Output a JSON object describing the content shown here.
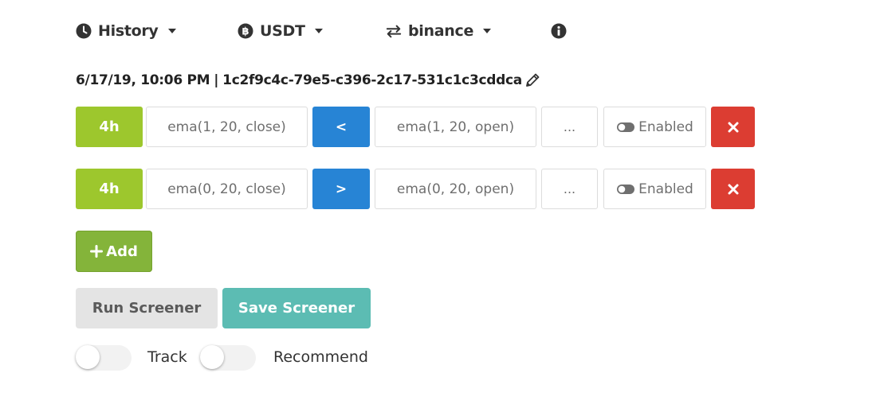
{
  "toolbar": {
    "history": {
      "label": "History",
      "icon": "clock-icon"
    },
    "currency": {
      "label": "USDT",
      "icon": "bitcoin-icon"
    },
    "exchange": {
      "label": "binance",
      "icon": "exchange-arrows-icon"
    },
    "info_icon": "info-icon"
  },
  "screener": {
    "date": "6/17/19, 10:06 PM",
    "separator": "|",
    "id": "1c2f9c4c-79e5-c396-2c17-531c1c3cddca",
    "edit_icon": "pencil-icon"
  },
  "conditions": [
    {
      "timeframe": "4h",
      "left": "ema(1, 20, close)",
      "operator": "<",
      "right": "ema(1, 20, open)",
      "more": "...",
      "enabled_label": "Enabled"
    },
    {
      "timeframe": "4h",
      "left": "ema(0, 20, close)",
      "operator": ">",
      "right": "ema(0, 20, open)",
      "more": "...",
      "enabled_label": "Enabled"
    }
  ],
  "actions": {
    "add_label": "Add",
    "run_label": "Run Screener",
    "save_label": "Save Screener"
  },
  "toggles": {
    "track_label": "Track",
    "recommend_label": "Recommend"
  },
  "colors": {
    "timeframe": "#9dc72d",
    "operator": "#2784d5",
    "delete": "#dc3d32",
    "add": "#84b43a",
    "save": "#5cbcb3",
    "run": "#e4e4e4"
  }
}
